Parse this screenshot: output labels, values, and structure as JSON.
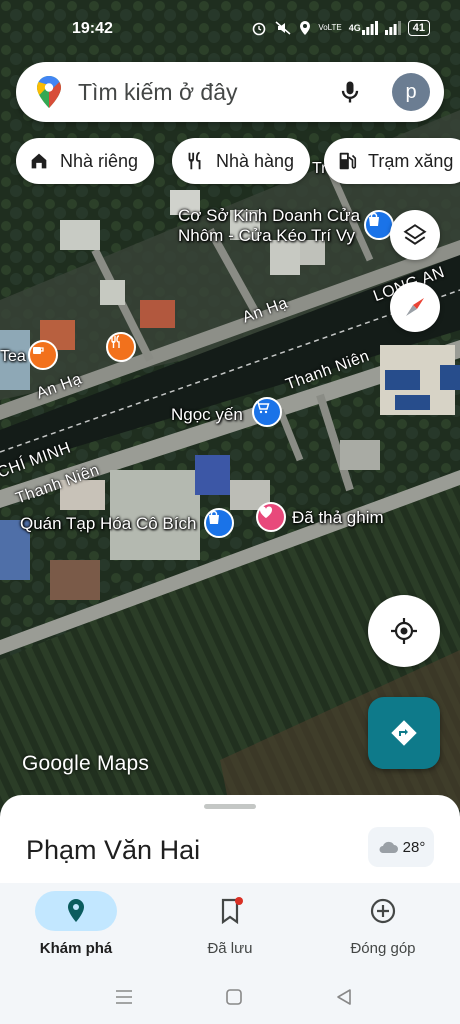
{
  "status_bar": {
    "time": "19:42",
    "network": "4G",
    "carrier_tag": "VoLTE",
    "battery": "41"
  },
  "search": {
    "placeholder": "Tìm kiếm ở đây",
    "avatar_letter": "p",
    "icons": [
      "google-maps-pin-logo",
      "mic-icon"
    ]
  },
  "chips": [
    {
      "label": "Nhà riêng",
      "icon": "home-icon"
    },
    {
      "label": "Nhà hàng",
      "icon": "restaurant-icon"
    },
    {
      "label": "Trạm xăng",
      "icon": "gas-station-icon"
    }
  ],
  "map": {
    "labels": {
      "poi_shop_name": "Cơ Sở Kinh Doanh Cửa\nNhôm - Cửa Kéo Trí Vy",
      "poi_ngoc_yen": "Ngọc yến",
      "poi_grocery": "Quán Tạp Hóa Cô Bích",
      "dropped_pin": "Đã thả ghim",
      "cafe_partial": "Tea",
      "district_long_an": "LONG AN",
      "district_hcm": "CHÍ MINH",
      "road_an_ha_1": "An Hạ",
      "road_an_ha_2": "An Hạ",
      "road_thanh_nien_1": "Thanh Niên",
      "road_thanh_nien_2": "Thanh Niên",
      "top_partial": "Tr"
    },
    "colors": {
      "shopping_pin": "#1a73e8",
      "food_pin": "#f2711c",
      "dropped_pin": "#e8497b"
    }
  },
  "watermark": "Google Maps",
  "sheet": {
    "place_name": "Phạm Văn Hai",
    "temperature": "28°",
    "weather_icon": "cloud-icon"
  },
  "bottom_nav": [
    {
      "label": "Khám phá",
      "icon": "explore-pin-icon",
      "active": true
    },
    {
      "label": "Đã lưu",
      "icon": "bookmark-icon",
      "active": false
    },
    {
      "label": "Đóng góp",
      "icon": "add-circle-icon",
      "active": false
    }
  ],
  "system_nav": [
    "menu-icon",
    "home-square-icon",
    "back-triangle-icon"
  ]
}
